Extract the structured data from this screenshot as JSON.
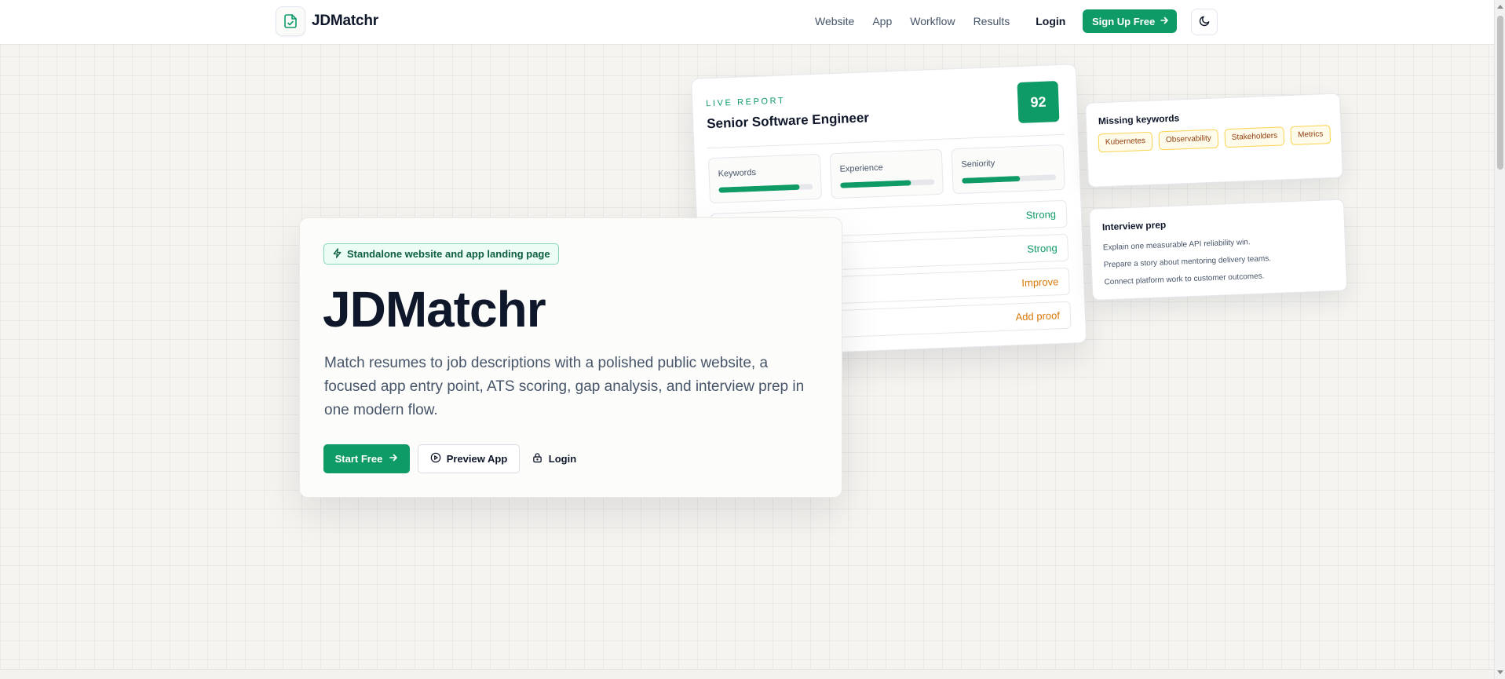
{
  "header": {
    "brand": "JDMatchr",
    "nav": [
      "Website",
      "App",
      "Workflow",
      "Results"
    ],
    "login_label": "Login",
    "signup_label": "Sign Up Free"
  },
  "report": {
    "eyebrow": "LIVE REPORT",
    "title": "Senior Software Engineer",
    "score": "92",
    "metrics": [
      {
        "label": "Keywords",
        "progress": 0.86
      },
      {
        "label": "Experience",
        "progress": 0.75
      },
      {
        "label": "Seniority",
        "progress": 0.62
      }
    ],
    "rows": [
      {
        "status": "Strong",
        "tone": "good"
      },
      {
        "status": "Strong",
        "tone": "good"
      },
      {
        "status": "Improve",
        "tone": "warn"
      },
      {
        "status": "Add proof",
        "tone": "warn"
      }
    ]
  },
  "missing_keywords": {
    "title": "Missing keywords",
    "chips": [
      "Kubernetes",
      "Observability",
      "Stakeholders",
      "Metrics"
    ]
  },
  "interview_prep": {
    "title": "Interview prep",
    "lines": [
      "Explain one measurable API reliability win.",
      "Prepare a story about mentoring delivery teams.",
      "Connect platform work to customer outcomes."
    ]
  },
  "hero": {
    "badge": "Standalone website and app landing page",
    "title": "JDMatchr",
    "description": "Match resumes to job descriptions with a polished public website, a focused app entry point, ATS scoring, gap analysis, and interview prep in one modern flow.",
    "primary_cta": "Start Free",
    "secondary_cta": "Preview App",
    "login_cta": "Login"
  },
  "colors": {
    "accent": "#0f9b66",
    "warning": "#d97706",
    "background": "#f5f4f0"
  },
  "icons": {
    "brand": "file-check-icon",
    "signup": "arrow-right-icon",
    "theme": "moon-icon",
    "badge": "lightning-icon",
    "start": "arrow-right-icon",
    "preview": "play-circle-icon",
    "login": "lock-icon"
  }
}
